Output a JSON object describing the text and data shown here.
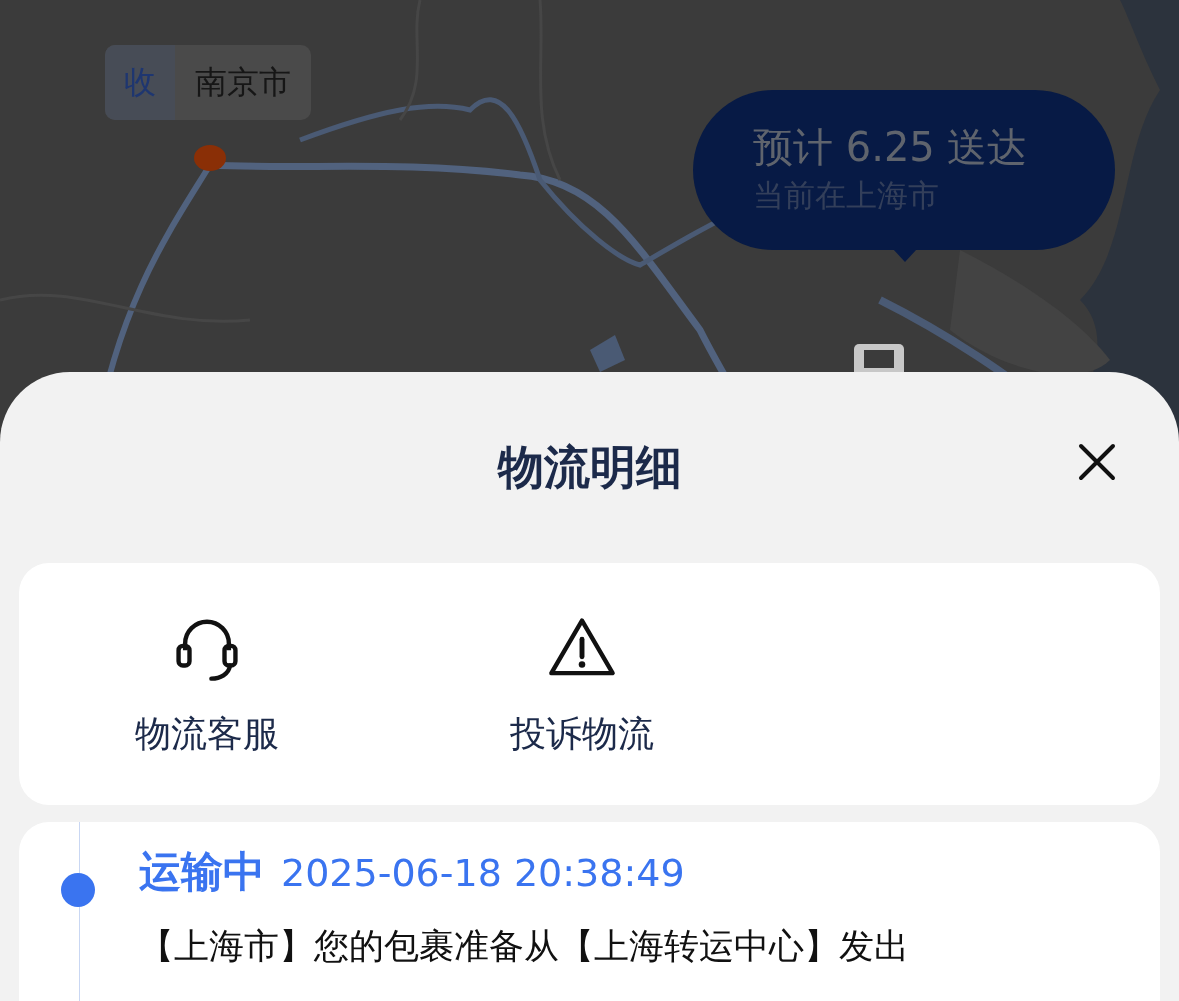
{
  "map": {
    "kind": "picture",
    "destination_tag": {
      "badge": "收",
      "city": "南京市"
    },
    "eta_bubble": {
      "title": "预计 6.25 送达",
      "subtitle": "当前在上海市"
    }
  },
  "sheet": {
    "title": "物流明细",
    "actions": [
      {
        "kind": "headset",
        "label": "物流客服"
      },
      {
        "kind": "warning",
        "label": "投诉物流"
      }
    ],
    "events": [
      {
        "status": "运输中",
        "time": "2025-06-18 20:38:49",
        "description": "【上海市】您的包裹准备从【上海转运中心】发出",
        "current": true
      }
    ]
  }
}
